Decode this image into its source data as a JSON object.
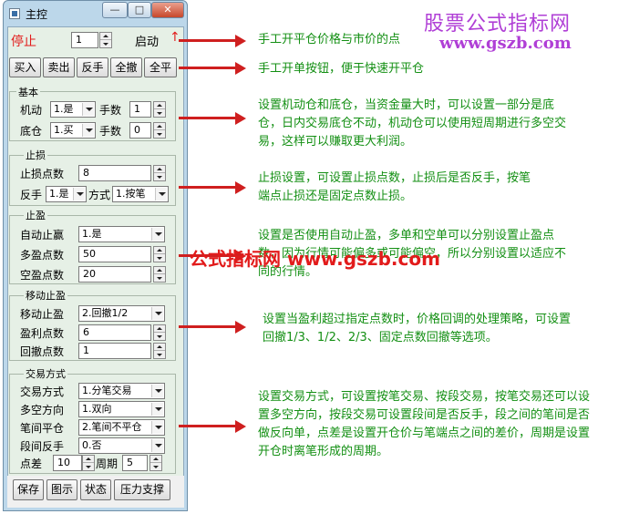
{
  "window": {
    "title": "主控",
    "min_glyph": "—",
    "max_glyph": "□",
    "close_glyph": "✕",
    "bg_color": "#bcd7ea",
    "client_color": "#e6f0e6"
  },
  "top": {
    "stop_label": "停止",
    "qty_value": "1",
    "start_label": "启动",
    "arrow_glyph": "↑"
  },
  "quick_buttons": [
    "买入",
    "卖出",
    "反手",
    "全撤",
    "全平"
  ],
  "basic": {
    "title": "基本",
    "row1_label": "机动",
    "row1_select": "1.是",
    "row1_qty_label": "手数",
    "row1_qty": "1",
    "row2_label": "底仓",
    "row2_select": "1.买",
    "row2_qty_label": "手数",
    "row2_qty": "0"
  },
  "stoploss": {
    "title": "止损",
    "points_label": "止损点数",
    "points_value": "8",
    "reverse_label": "反手",
    "reverse_select": "1.是",
    "mode_label": "方式",
    "mode_select": "1.按笔"
  },
  "takeprofit": {
    "title": "止盈",
    "auto_label": "自动止赢",
    "auto_select": "1.是",
    "long_label": "多盈点数",
    "long_value": "50",
    "short_label": "空盈点数",
    "short_value": "20"
  },
  "trailing": {
    "title": "移动止盈",
    "mode_label": "移动止盈",
    "mode_select": "2.回撤1/2",
    "profit_label": "盈利点数",
    "profit_value": "6",
    "pullback_label": "回撤点数",
    "pullback_value": "1"
  },
  "tradeway": {
    "title": "交易方式",
    "way_label": "交易方式",
    "way_select": "1.分笔交易",
    "dir_label": "多空方向",
    "dir_select": "1.双向",
    "flat_label": "笔间平仓",
    "flat_select": "2.笔间不平仓",
    "rev_label": "段间反手",
    "rev_select": "0.否",
    "diff_label": "点差",
    "diff_value": "10",
    "period_label": "周期",
    "period_value": "5"
  },
  "bottom_buttons": [
    "保存",
    "图示",
    "状态",
    "压力支撑"
  ],
  "watermark": {
    "brand_top": "股票公式指标网",
    "url_top": "www.gszb.com",
    "overlay_text": "公式指标网 www.gszb.com"
  },
  "notes": [
    "手工开平仓价格与市价的点",
    "手工开单按钮，便于快速开平仓",
    "设置机动仓和底仓，当资金量大时，可以设置一部分是底仓，日内交易底仓不动，机动仓可以使用短周期进行多空交易，这样可以赚取更大利润。",
    "止损设置，可设置止损点数，止损后是否反手，按笔端点止损还是固定点数止损。",
    "设置是否使用自动止盈，多单和空单可以分别设置止盈点数，因为行情可能偏多或可能偏空，所以分别设置以适应不同的行情。",
    "设置当盈利超过指定点数时，价格回调的处理策略，可设置回撤1/3、1/2、2/3、固定点数回撤等选项。",
    "设置交易方式，可设置按笔交易、按段交易，按笔交易还可以设置多空方向，按段交易可设置段间是否反手，段之间的笔间是否做反向单，点差是设置开仓价与笔端点之间的差价，周期是设置开仓时离笔形成的周期。"
  ],
  "colors": {
    "note_green": "#138f13",
    "arrow_red": "#cf1f1f",
    "brand_purple": "#b03fd6",
    "overlay_red": "#e21b1b"
  }
}
